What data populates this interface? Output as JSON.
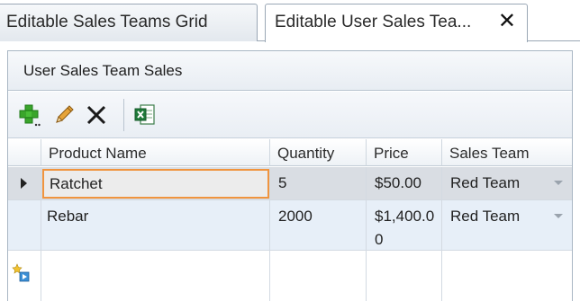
{
  "tabs": [
    {
      "label": "Editable Sales Teams Grid",
      "active": false
    },
    {
      "label": "Editable User Sales Tea...",
      "active": true
    }
  ],
  "panel": {
    "title": "User Sales Team Sales"
  },
  "toolbar": {
    "buttons": [
      {
        "icon": "add-icon"
      },
      {
        "icon": "edit-pencil-icon"
      },
      {
        "icon": "delete-x-icon"
      },
      {
        "icon": "excel-export-icon"
      }
    ]
  },
  "grid": {
    "columns": [
      "Product Name",
      "Quantity",
      "Price",
      "Sales Team"
    ],
    "rows": [
      {
        "product": "Ratchet",
        "quantity": "5",
        "price": "$50.00",
        "team": "Red Team",
        "selected": true
      },
      {
        "product": "Rebar",
        "quantity": "2000",
        "price": "$1,400.00",
        "team": "Red Team",
        "selected": false
      }
    ]
  },
  "colors": {
    "editor_border": "#f0943e",
    "selected_row": "#d9dde3",
    "alt_row": "#e7eff8",
    "header_bg": "#eef2f6"
  }
}
